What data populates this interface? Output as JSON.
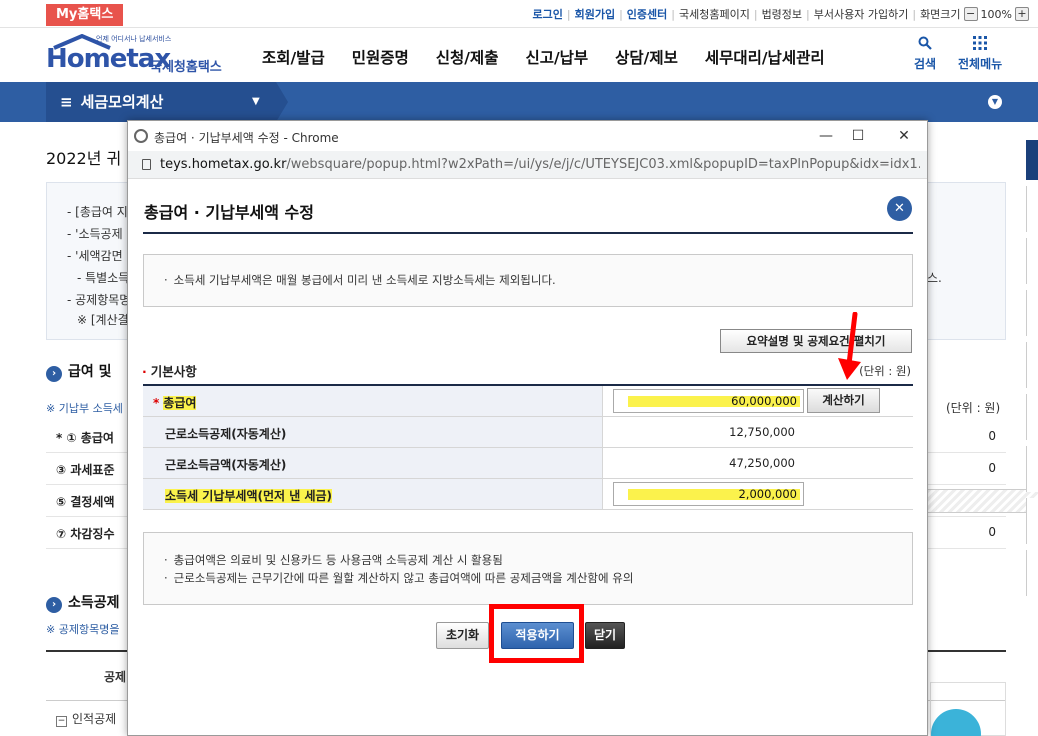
{
  "topbar": {
    "my_hometax": "My홈택스",
    "links": [
      "로그인",
      "회원가입",
      "인증센터",
      "국세청홈페이지",
      "법령정보",
      "부서사용자 가입하기",
      "화면크기"
    ],
    "zoom_minus": "−",
    "zoom": "100%",
    "zoom_plus": "+"
  },
  "header": {
    "logo_sub": "언제 어디서나 납세서비스",
    "logo_main": "Hometax",
    "logo_kor": "국세청홈택스",
    "nav": [
      "조회/발급",
      "민원증명",
      "신청/제출",
      "신고/납부",
      "상담/제보",
      "세무대리/납세관리"
    ],
    "search_label": "검색",
    "menu_label": "전체메뉴"
  },
  "menubar": {
    "current": "세금모의계산"
  },
  "background": {
    "page_title": "2022년 귀",
    "info_lines": [
      "- [총급여 지",
      "- '소득공제",
      "- '세액감면",
      "- 특별소득",
      "- 공제항목명",
      "※ [계산결",
      "스."
    ],
    "section1": "급여 및",
    "note1": "※ 기납부 소득세",
    "unit": "(단위 : 원)",
    "rows": [
      {
        "label": "* ① 총급여",
        "value": "0"
      },
      {
        "label": "③ 과세표준",
        "value": "0"
      },
      {
        "label": "⑤ 결정세액",
        "value": ""
      },
      {
        "label": "⑦ 차감징수",
        "value": "0"
      }
    ],
    "section2": "소득공제",
    "note2": "※ 공제항목명을",
    "col_header": "공제",
    "tree_item": "인적공제"
  },
  "popup": {
    "window_title": "총급여 · 기납부세액 수정 - Chrome",
    "url_host": "teys.hometax.go.kr",
    "url_rest": "/websquare/popup.html?w2xPath=/ui/ys/e/j/c/UTEYSEJC03.xml&popupID=taxPlnPopup&idx=idx1...",
    "heading": "총급여 · 기납부세액 수정",
    "notice_top": "소득세 기납부세액은 매월 봉급에서 미리 낸 소득세로 지방소득세는 제외됩니다.",
    "summary_button": "요약설명 및 공제요건 펼치기",
    "basic_title": "기본사항",
    "unit": "(단위 : 원)",
    "rows": {
      "gross_pay_label": "총급여",
      "gross_pay_value": "60,000,000",
      "calc_button": "계산하기",
      "earned_deduction_label": "근로소득공제(자동계산)",
      "earned_deduction_value": "12,750,000",
      "earned_income_label": "근로소득금액(자동계산)",
      "earned_income_value": "47,250,000",
      "prepaid_tax_label": "소득세 기납부세액(먼저 낸 세금)",
      "prepaid_tax_value": "2,000,000"
    },
    "notice_bottom": [
      "총급여액은 의료비 및 신용카드 등 사용금액 소득공제 계산 시 활용됨",
      "근로소득공제는 근무기간에 따른 월할 계산하지 않고 총급여액에 따른 공제금액을 계산함에 유의"
    ],
    "buttons": {
      "reset": "초기화",
      "apply": "적용하기",
      "close": "닫기"
    }
  },
  "colors": {
    "brand_blue": "#2e5ea3",
    "highlight": "#fbf24c",
    "annotation_red": "#ff0000"
  }
}
